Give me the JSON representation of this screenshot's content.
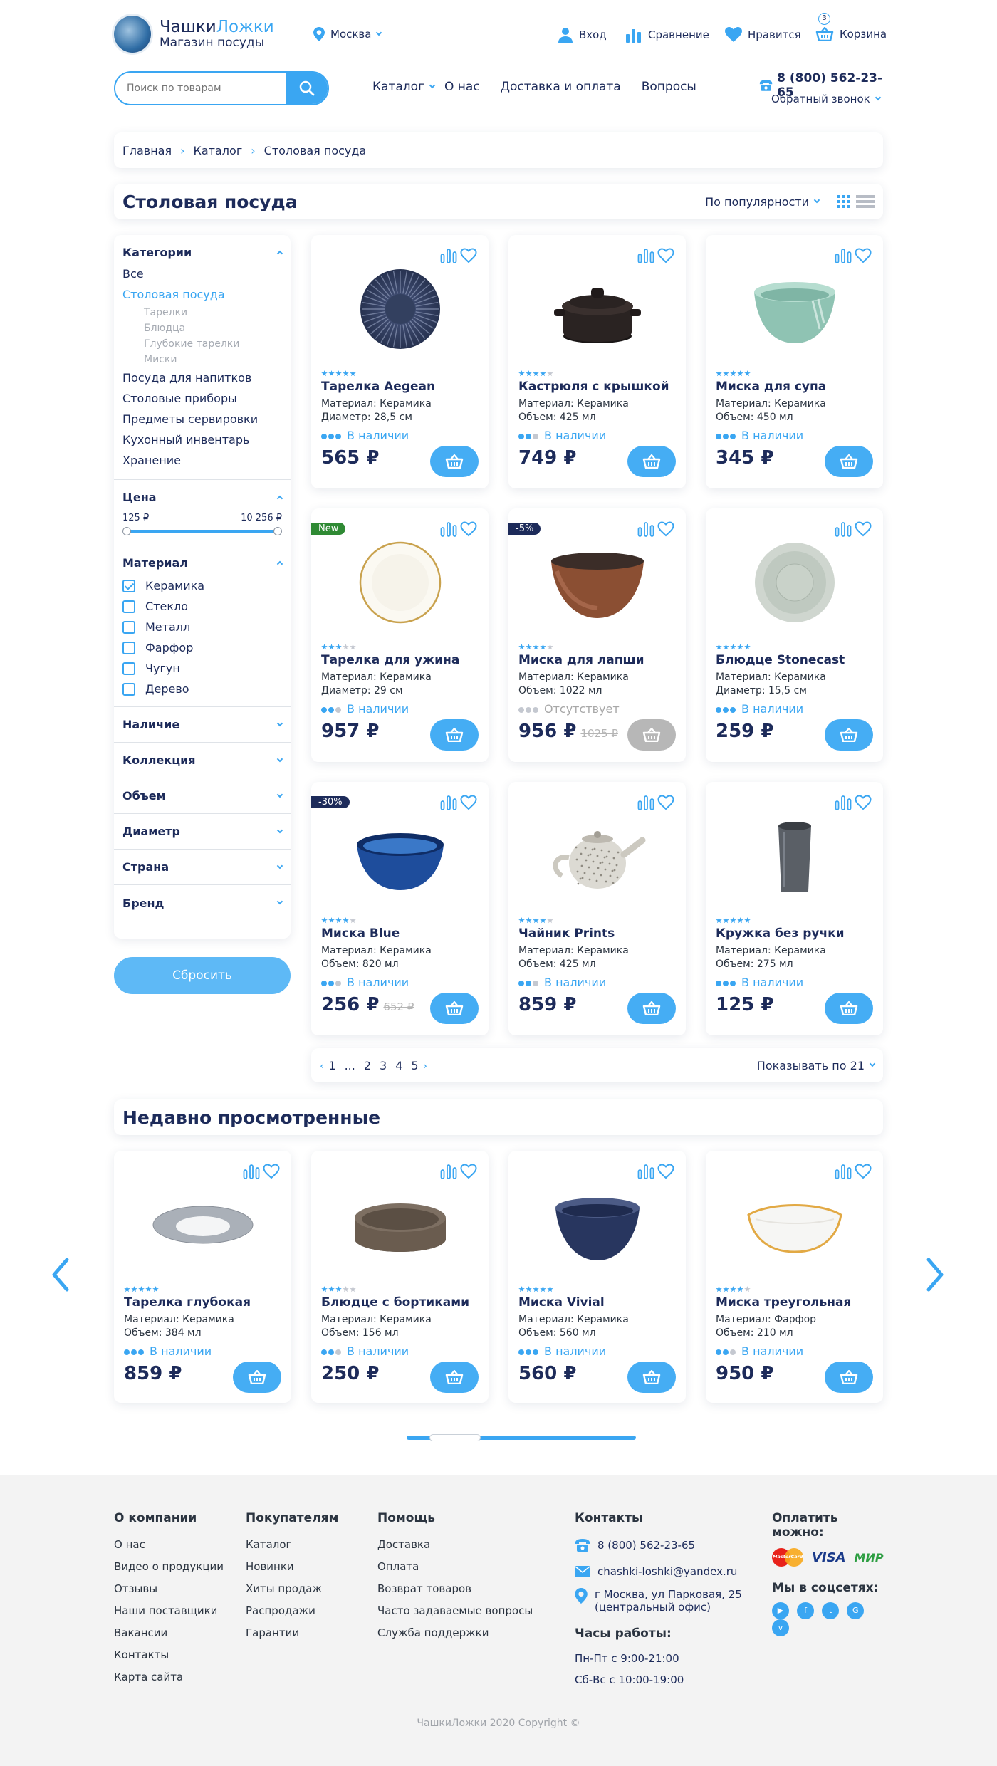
{
  "header": {
    "logo_title_1": "Чашки",
    "logo_title_2": "Ложки",
    "logo_subtitle": "Магазин посуды",
    "city": "Москва",
    "login": "Вход",
    "compare": "Сравнение",
    "like": "Нравится",
    "cart": "Корзина",
    "cart_count": "3",
    "search_placeholder": "Поиск по товарам",
    "nav": [
      "Каталог",
      "О нас",
      "Доставка и оплата",
      "Вопросы"
    ],
    "phone": "8 (800) 562-23-65",
    "callback": "Обратный звонок"
  },
  "breadcrumb": [
    "Главная",
    "Каталог",
    "Столовая посуда"
  ],
  "page": {
    "title": "Столовая посуда",
    "sort": "По популярности"
  },
  "filters": {
    "categories_title": "Категории",
    "categories": [
      {
        "label": "Все",
        "level": 0,
        "active": false
      },
      {
        "label": "Столовая посуда",
        "level": 0,
        "active": true
      },
      {
        "label": "Тарелки",
        "level": 1,
        "active": false
      },
      {
        "label": "Блюдца",
        "level": 1,
        "active": false
      },
      {
        "label": "Глубокие тарелки",
        "level": 1,
        "active": false
      },
      {
        "label": "Миски",
        "level": 1,
        "active": false
      },
      {
        "label": "Посуда для напитков",
        "level": 0,
        "active": false
      },
      {
        "label": "Столовые приборы",
        "level": 0,
        "active": false
      },
      {
        "label": "Предметы сервировки",
        "level": 0,
        "active": false
      },
      {
        "label": "Кухонный инвентарь",
        "level": 0,
        "active": false
      },
      {
        "label": "Хранение",
        "level": 0,
        "active": false
      }
    ],
    "price_title": "Цена",
    "price_min": "125 ₽",
    "price_max": "10 256 ₽",
    "material_title": "Материал",
    "materials": [
      {
        "label": "Керамика",
        "checked": true
      },
      {
        "label": "Стекло",
        "checked": false
      },
      {
        "label": "Металл",
        "checked": false
      },
      {
        "label": "Фарфор",
        "checked": false
      },
      {
        "label": "Чугун",
        "checked": false
      },
      {
        "label": "Дерево",
        "checked": false
      }
    ],
    "collapsed": [
      "Наличие",
      "Коллекция",
      "Объем",
      "Диаметр",
      "Страна",
      "Бренд"
    ],
    "reset": "Сбросить"
  },
  "products": [
    {
      "name": "Тарелка Aegean",
      "attr1": "Материал: Керамика",
      "attr2": "Диаметр: 28,5 см",
      "stock": "В наличии",
      "in_stock": true,
      "price": "565 ₽",
      "old": "",
      "badge": "",
      "rating": 5,
      "img": "plate-dark"
    },
    {
      "name": "Кастрюля с крышкой",
      "attr1": "Материал: Керамика",
      "attr2": "Объем: 425 мл",
      "stock": "В наличии",
      "in_stock": true,
      "price": "749 ₽",
      "old": "",
      "badge": "",
      "rating": 4,
      "img": "pot"
    },
    {
      "name": "Миска для супа",
      "attr1": "Материал: Керамика",
      "attr2": "Объем: 450 мл",
      "stock": "В наличии",
      "in_stock": true,
      "price": "345 ₽",
      "old": "",
      "badge": "",
      "rating": 5,
      "img": "bowl-mint"
    },
    {
      "name": "Тарелка  для ужина",
      "attr1": "Материал: Керамика",
      "attr2": "Диаметр: 29 см",
      "stock": "В наличии",
      "in_stock": true,
      "price": "957 ₽",
      "old": "",
      "badge": "New",
      "rating": 3,
      "img": "plate-white"
    },
    {
      "name": "Миска для лапши",
      "attr1": "Материал: Керамика",
      "attr2": "Объем: 1022 мл",
      "stock": "Отсутствует",
      "in_stock": false,
      "price": "956 ₽",
      "old": "1025 ₽",
      "badge": "-5%",
      "rating": 4,
      "img": "bowl-brown"
    },
    {
      "name": "Блюдце Stonecast",
      "attr1": "Материал: Керамика",
      "attr2": "Диаметр: 15,5 см",
      "stock": "В наличии",
      "in_stock": true,
      "price": "259 ₽",
      "old": "",
      "badge": "",
      "rating": 5,
      "img": "saucer"
    },
    {
      "name": "Миска Blue",
      "attr1": "Материал: Керамика",
      "attr2": "Объем: 820 мл",
      "stock": "В наличии",
      "in_stock": true,
      "price": "256 ₽",
      "old": "652 ₽",
      "badge": "-30%",
      "rating": 4,
      "img": "bowl-blue"
    },
    {
      "name": "Чайник Prints",
      "attr1": "Материал: Керамика",
      "attr2": "Объем: 425 мл",
      "stock": "В наличии",
      "in_stock": true,
      "price": "859 ₽",
      "old": "",
      "badge": "",
      "rating": 4,
      "img": "teapot"
    },
    {
      "name": "Кружка без ручки",
      "attr1": "Материал: Керамика",
      "attr2": "Объем: 275 мл",
      "stock": "В наличии",
      "in_stock": true,
      "price": "125 ₽",
      "old": "",
      "badge": "",
      "rating": 5,
      "img": "cup"
    }
  ],
  "pagination": {
    "pages": [
      "1",
      "...",
      "2",
      "3",
      "4",
      "5"
    ],
    "per_page": "Показывать по 21"
  },
  "recent": {
    "title": "Недавно просмотренные",
    "items": [
      {
        "name": "Тарелка глубокая",
        "attr1": "Материал: Керамика",
        "attr2": "Объем: 384 мл",
        "stock": "В наличии",
        "price": "859 ₽",
        "rating": 5,
        "img": "deep-plate"
      },
      {
        "name": "Блюдце с бортиками",
        "attr1": "Материал: Керамика",
        "attr2": "Объем: 156 мл",
        "stock": "В наличии",
        "price": "250 ₽",
        "rating": 3,
        "img": "dish-brown"
      },
      {
        "name": "Миска Vivial",
        "attr1": "Материал: Керамика",
        "attr2": "Объем: 560 мл",
        "stock": "В наличии",
        "price": "560 ₽",
        "rating": 5,
        "img": "bowl-navy"
      },
      {
        "name": "Миска треугольная",
        "attr1": "Материал: Фарфор",
        "attr2": "Объем: 210 мл",
        "stock": "В наличии",
        "price": "950 ₽",
        "rating": 4,
        "img": "tri-bowl"
      }
    ],
    "scroll_position": 0.1
  },
  "footer": {
    "col1_title": "О компании",
    "col1": [
      "О нас",
      "Видео о продукции",
      "Отзывы",
      "Наши поставщики",
      "Вакансии",
      "Контакты",
      "Карта сайта"
    ],
    "col2_title": "Покупателям",
    "col2": [
      "Каталог",
      "Новинки",
      "Хиты продаж",
      "Распродажи",
      "Гарантии"
    ],
    "col3_title": "Помощь",
    "col3": [
      "Доставка",
      "Оплата",
      "Возврат товаров",
      "Часто задаваемые вопросы",
      "Служба поддержки"
    ],
    "contacts_title": "Контакты",
    "phone": "8 (800) 562-23-65",
    "email": "chashki-loshki@yandex.ru",
    "address_1": "г Москва, ул Парковая, 25",
    "address_2": "(центральный офис)",
    "hours_title": "Часы работы:",
    "hours_1": "Пн-Пт с 9:00-21:00",
    "hours_2": "Сб-Вс с 10:00-19:00",
    "pay_title": "Оплатить можно:",
    "pay_visa": "VISA",
    "pay_mir": "МИР",
    "pay_mc": "MasterCard",
    "social_title": "Мы в соцсетях:",
    "copyright": "ЧашкиЛожки  2020  Copyright ©"
  },
  "colors": {
    "accent": "#3aa6f2",
    "text": "#1d2b5a",
    "badge_dark": "#1d2b5a",
    "badge_green": "#2f8a34"
  }
}
